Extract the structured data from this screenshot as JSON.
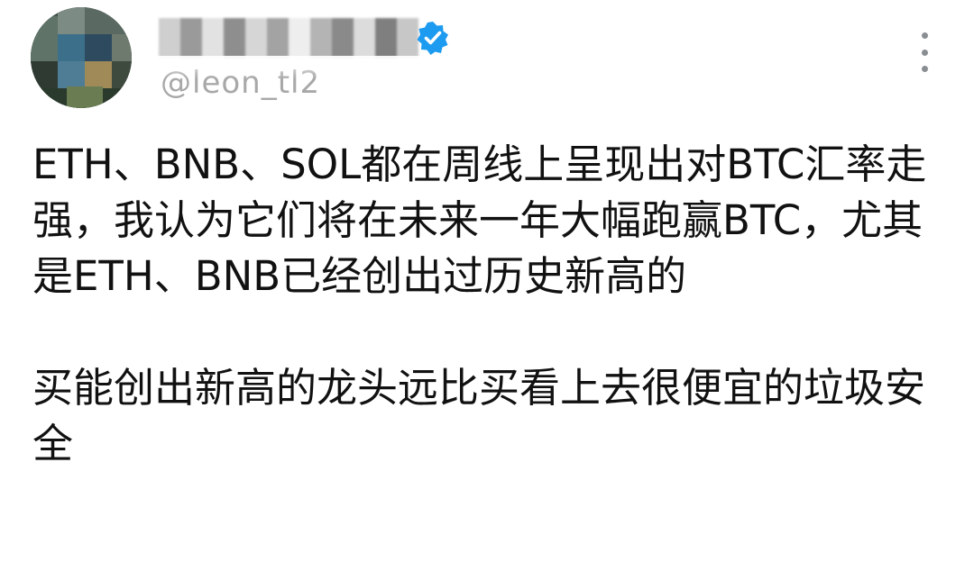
{
  "tweet": {
    "author": {
      "handle": "@leon_tl2",
      "verified_color": "#1d9bf0"
    },
    "menu": {
      "icon": "more-vertical-icon"
    },
    "text": "ETH、BNB、SOL都在周线上呈现出对BTC汇率走强，我认为它们将在未来一年大幅跑赢BTC，尤其是ETH、BNB已经创出过历史新高的\n\n买能创出新高的龙头远比买看上去很便宜的垃圾安全"
  }
}
